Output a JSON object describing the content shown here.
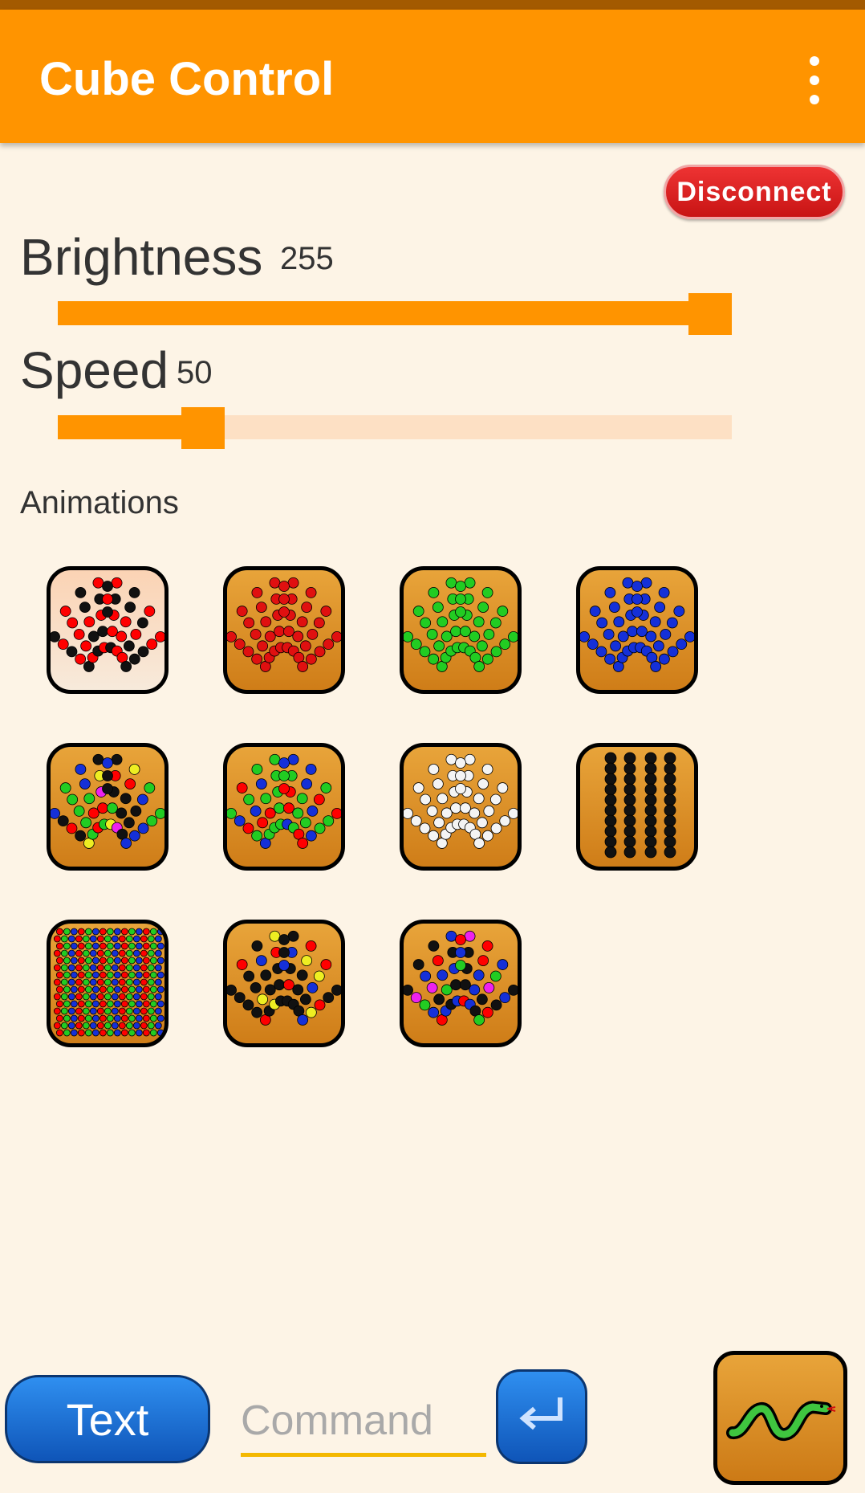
{
  "app": {
    "title": "Cube Control",
    "overflow_icon": "more-vert-icon",
    "accent": "#ff9400",
    "background": "#fdf4e6"
  },
  "connection": {
    "disconnect_label": "Disconnect",
    "color": "#dd2222"
  },
  "controls": {
    "brightness": {
      "label": "Brightness",
      "value": "255",
      "max": 255
    },
    "speed": {
      "label": "Speed",
      "value": "50",
      "max": 255
    }
  },
  "animations": {
    "label": "Animations",
    "items": [
      {
        "icon": "red-black-pattern-icon",
        "palette": [
          "#ff0000",
          "#111111"
        ],
        "bg": "light"
      },
      {
        "icon": "red-leds-icon",
        "palette": [
          "#e01010"
        ],
        "bg": "orange"
      },
      {
        "icon": "green-leds-icon",
        "palette": [
          "#22cc22"
        ],
        "bg": "orange"
      },
      {
        "icon": "blue-leds-icon",
        "palette": [
          "#1530d8"
        ],
        "bg": "orange"
      },
      {
        "icon": "multicolor-sparkle-icon",
        "palette": [
          "#111111",
          "#111111",
          "#111111",
          "#1530d8",
          "#22cc22",
          "#ff0000",
          "#ee22ee",
          "#eeee22"
        ],
        "bg": "orange"
      },
      {
        "icon": "rgb-mix-icon",
        "palette": [
          "#ff0000",
          "#22cc22",
          "#1530d8"
        ],
        "bg": "orange"
      },
      {
        "icon": "white-leds-icon",
        "palette": [
          "#f4f4f4"
        ],
        "bg": "orange"
      },
      {
        "icon": "rain-columns-icon",
        "palette": [
          "#111111",
          "#111111",
          "#111111",
          "#ff0000"
        ],
        "bg": "orange",
        "columns": true
      },
      {
        "icon": "dense-rgb-cube-icon",
        "palette": [
          "#ff0000",
          "#22cc22",
          "#1530d8"
        ],
        "bg": "orange",
        "dense": true
      },
      {
        "icon": "black-sparkle-icon",
        "palette": [
          "#111111",
          "#111111",
          "#111111",
          "#111111",
          "#1530d8",
          "#eeee22",
          "#ff0000"
        ],
        "bg": "orange"
      },
      {
        "icon": "color-wipe-icon",
        "palette": [
          "#111111",
          "#111111",
          "#ee22ee",
          "#22cc22",
          "#1530d8",
          "#ff0000"
        ],
        "bg": "orange"
      }
    ]
  },
  "command_bar": {
    "text_button_label": "Text",
    "command_placeholder": "Command",
    "enter_icon": "enter-return-icon",
    "snake_icon": "snake-game-icon"
  }
}
